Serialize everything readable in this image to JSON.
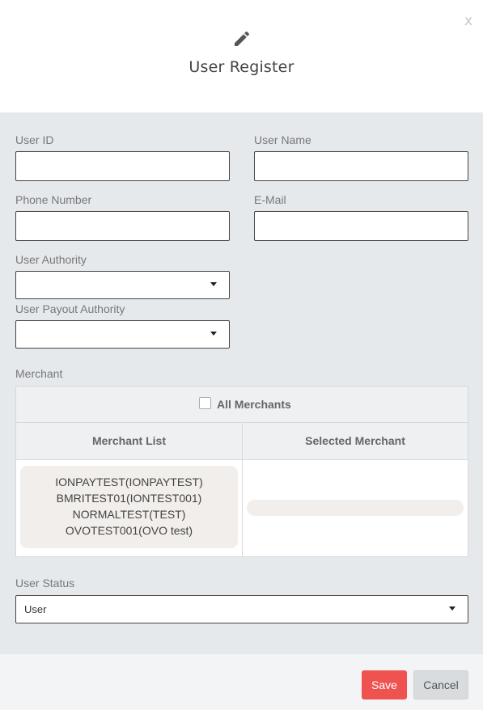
{
  "dialog": {
    "title": "User Register",
    "close_label": "x",
    "icon": "pencil-icon"
  },
  "form": {
    "user_id": {
      "label": "User ID",
      "value": ""
    },
    "user_name": {
      "label": "User Name",
      "value": ""
    },
    "phone_number": {
      "label": "Phone Number",
      "value": ""
    },
    "email": {
      "label": "E-Mail",
      "value": ""
    },
    "user_authority": {
      "label": "User Authority",
      "value": ""
    },
    "user_payout_authority": {
      "label": "User Payout Authority",
      "value": ""
    },
    "merchant": {
      "label": "Merchant",
      "all_merchants_label": "All Merchants",
      "all_merchants_checked": false,
      "list_header": "Merchant List",
      "selected_header": "Selected Merchant",
      "list": [
        "IONPAYTEST(IONPAYTEST)",
        "BMRITEST01(IONTEST001)",
        "NORMALTEST(TEST)",
        "OVOTEST001(OVO test)"
      ],
      "selected": []
    },
    "user_status": {
      "label": "User Status",
      "value": "User"
    }
  },
  "footer": {
    "save_label": "Save",
    "cancel_label": "Cancel"
  },
  "colors": {
    "save": "#ef5350",
    "body_bg": "#e6e9ec"
  }
}
